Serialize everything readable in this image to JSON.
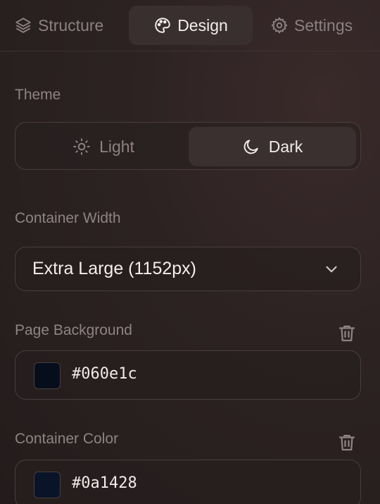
{
  "tabs": [
    {
      "label": "Structure",
      "icon": "layers-icon",
      "active": false
    },
    {
      "label": "Design",
      "icon": "palette-icon",
      "active": true
    },
    {
      "label": "Settings",
      "icon": "gear-icon",
      "active": false
    }
  ],
  "theme": {
    "label": "Theme",
    "options": [
      {
        "label": "Light",
        "icon": "sun-icon",
        "selected": false
      },
      {
        "label": "Dark",
        "icon": "moon-icon",
        "selected": true
      }
    ]
  },
  "container_width": {
    "label": "Container Width",
    "value": "Extra Large (1152px)"
  },
  "page_background": {
    "label": "Page Background",
    "value": "#060e1c",
    "swatch": "#060e1c"
  },
  "container_color": {
    "label": "Container Color",
    "value": "#0a1428",
    "swatch": "#0a1428"
  },
  "colors": {
    "accent_active_tab": "#3a2f2f",
    "border": "#4a3d3d"
  }
}
